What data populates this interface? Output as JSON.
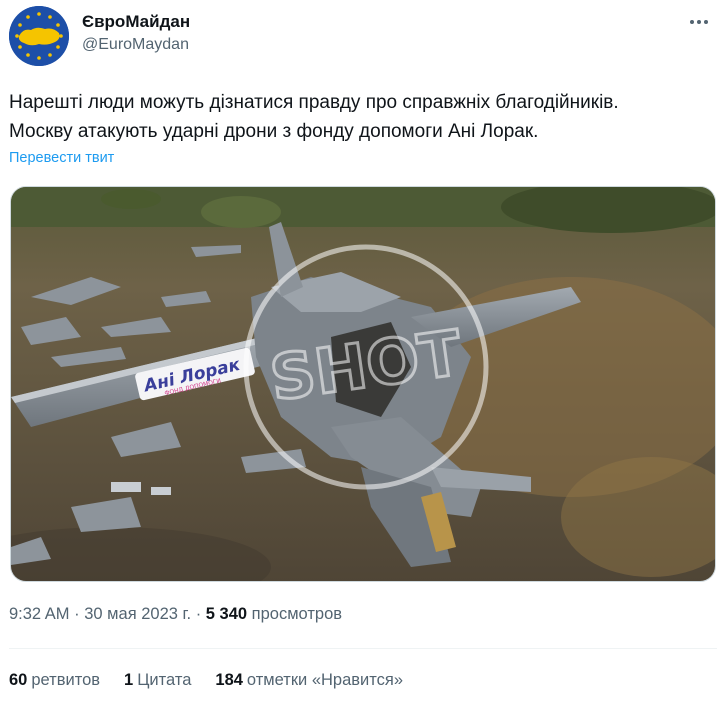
{
  "author": {
    "display_name": "ЄвроМайдан",
    "handle": "@EuroMaydan"
  },
  "tweet": {
    "line1": "Нарешті люди можуть дізнатися правду про справжніх благодійників.",
    "line2": "Москву атакують ударні дрони з фонду допомоги Ані Лорак.",
    "translate_label": "Перевести твит"
  },
  "media": {
    "wing_text": "Ані Лорак",
    "wing_subtext": "ФОНД ДОПОМОГИ",
    "watermark": "SHOT"
  },
  "meta": {
    "time": "9:32 AM",
    "date": "30 мая 2023 г.",
    "views_count": "5 340",
    "views_label": "просмотров"
  },
  "stats": {
    "retweets_count": "60",
    "retweets_label": "ретвитов",
    "quotes_count": "1",
    "quotes_label": "Цитата",
    "likes_count": "184",
    "likes_label": "отметки «Нравится»"
  },
  "colors": {
    "link": "#1d9bf0",
    "muted": "#536471",
    "avatar_blue": "#1d4fa8",
    "avatar_yellow": "#f5c400"
  }
}
